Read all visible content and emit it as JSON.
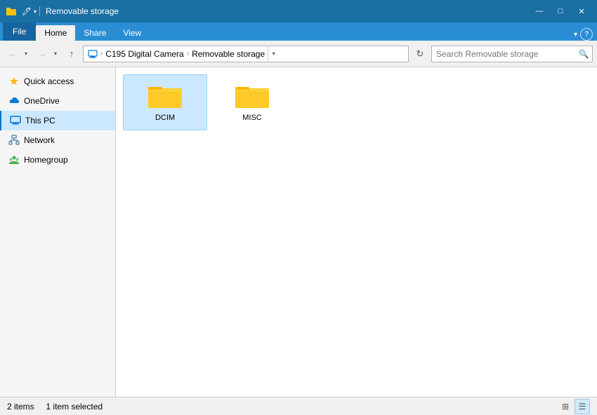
{
  "titlebar": {
    "title": "Removable storage",
    "icon": "📁",
    "minimize": "—",
    "maximize": "□",
    "close": "✕"
  },
  "ribbon": {
    "file_tab": "File",
    "tabs": [
      "Home",
      "Share",
      "View"
    ],
    "active_tab": "Home",
    "collapse_arrow": "▾",
    "help": "?"
  },
  "toolbar": {
    "back": "←",
    "forward": "→",
    "up": "↑",
    "address": {
      "this_pc_icon": "💻",
      "segments": [
        "This PC",
        "C195 Digital Camera",
        "Removable storage"
      ]
    },
    "refresh": "↻",
    "search_placeholder": "Search Removable storage"
  },
  "sidebar": {
    "items": [
      {
        "id": "quick-access",
        "label": "Quick access",
        "icon_type": "star",
        "active": false
      },
      {
        "id": "onedrive",
        "label": "OneDrive",
        "icon_type": "cloud",
        "active": false
      },
      {
        "id": "this-pc",
        "label": "This PC",
        "icon_type": "monitor",
        "active": true
      },
      {
        "id": "network",
        "label": "Network",
        "icon_type": "network",
        "active": false
      },
      {
        "id": "homegroup",
        "label": "Homegroup",
        "icon_type": "homegroup",
        "active": false
      }
    ]
  },
  "content": {
    "folders": [
      {
        "name": "DCIM",
        "selected": true
      },
      {
        "name": "MISC",
        "selected": false
      }
    ]
  },
  "statusbar": {
    "count": "2 items",
    "selection": "1 item selected",
    "view_grid": "⊞",
    "view_list": "☰"
  }
}
